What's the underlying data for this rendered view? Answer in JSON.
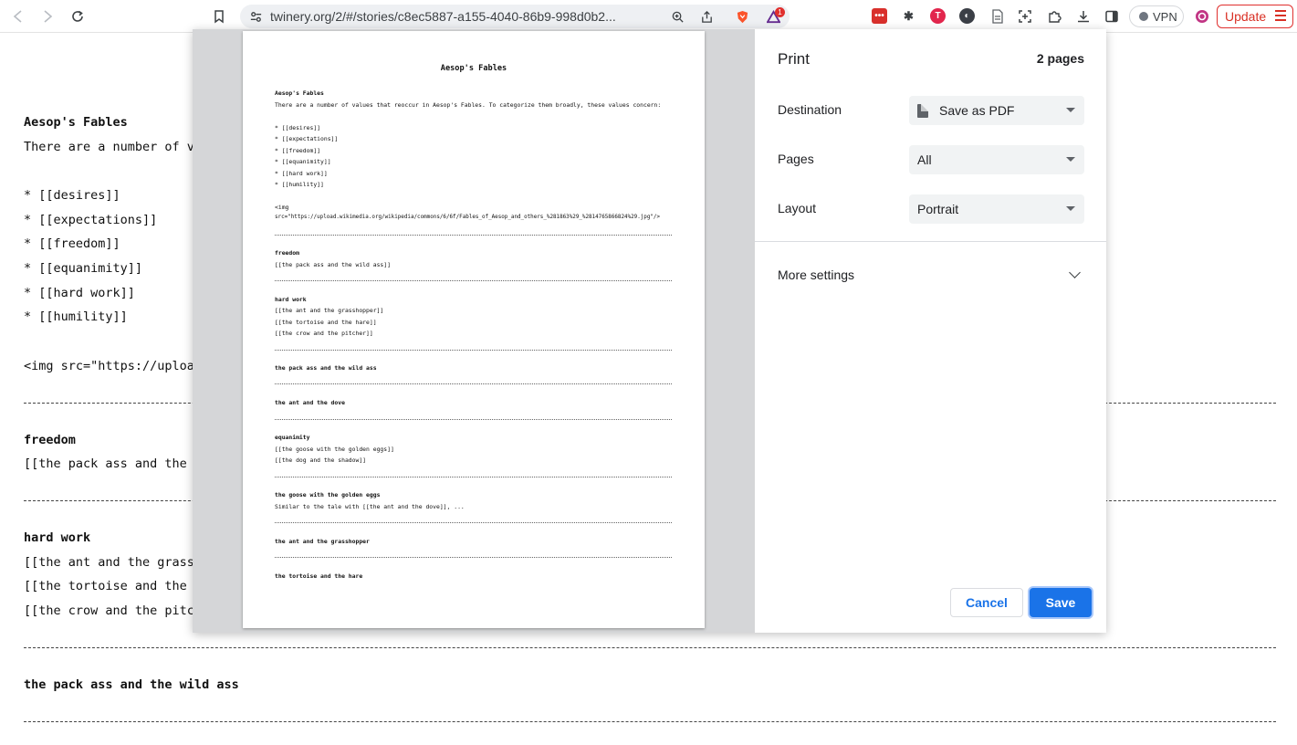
{
  "browser": {
    "url": "twinery.org/2/#/stories/c8ec5887-a155-4040-86b9-998d0b2...",
    "vpn_label": "VPN",
    "update_label": "Update",
    "notification_count": "1",
    "accent_update": "#d93025"
  },
  "background_page": {
    "title": "Aesop's Fables",
    "intro": "There are a number of va",
    "list_items": [
      "* [[desires]]",
      "* [[expectations]]",
      "* [[freedom]]",
      "* [[equanimity]]",
      "* [[hard work]]",
      "* [[humility]]"
    ],
    "img_line": "<img src=\"https://uploa",
    "freedom_heading": "freedom",
    "freedom_link": "[[the pack ass and the w",
    "hardwork_heading": "hard work",
    "hardwork_links": [
      "[[the ant and the grassh",
      "[[the tortoise and the h",
      "[[the crow and the pitch"
    ],
    "packass_heading": "the pack ass and the wild ass"
  },
  "print_dialog": {
    "title": "Print",
    "page_count": "2 pages",
    "destination_label": "Destination",
    "destination_value": "Save as PDF",
    "pages_label": "Pages",
    "pages_value": "All",
    "layout_label": "Layout",
    "layout_value": "Portrait",
    "more_settings": "More settings",
    "cancel_label": "Cancel",
    "save_label": "Save",
    "accent": "#1a73e8"
  },
  "preview": {
    "title": "Aesop's Fables",
    "heading": "Aesop's Fables",
    "intro": "There are a number of values that reoccur in Aesop's Fables. To categorize them broadly, these values concern:",
    "list_items": [
      "* [[desires]]",
      "* [[expectations]]",
      "* [[freedom]]",
      "* [[equanimity]]",
      "* [[hard work]]",
      "* [[humility]]"
    ],
    "img_open": "<img",
    "img_src": "src=\"https://upload.wikimedia.org/wikipedia/commons/6/6f/Fables_of_Aesop_and_others_%281863%29_%2814765866824%29.jpg\"/>",
    "freedom_heading": "freedom",
    "freedom_link": "[[the pack ass and the wild ass]]",
    "hardwork_heading": "hard work",
    "hardwork_links": [
      "[[the ant and the grasshopper]]",
      "[[the tortoise and the hare]]",
      "[[the crow and the pitcher]]"
    ],
    "packass_heading": "the pack ass and the wild ass",
    "antdove_heading": "the ant and the dove",
    "equanimity_heading": "equanimity",
    "equanimity_links": [
      "[[the goose with the golden eggs]]",
      "[[the dog and the shadow]]"
    ],
    "goose_heading": "the goose with the golden eggs",
    "goose_text": "Similar to the tale with [[the ant and the dove]], ...",
    "antgrass_heading": "the ant and the grasshopper",
    "tortoise_heading": "the tortoise and the hare"
  }
}
